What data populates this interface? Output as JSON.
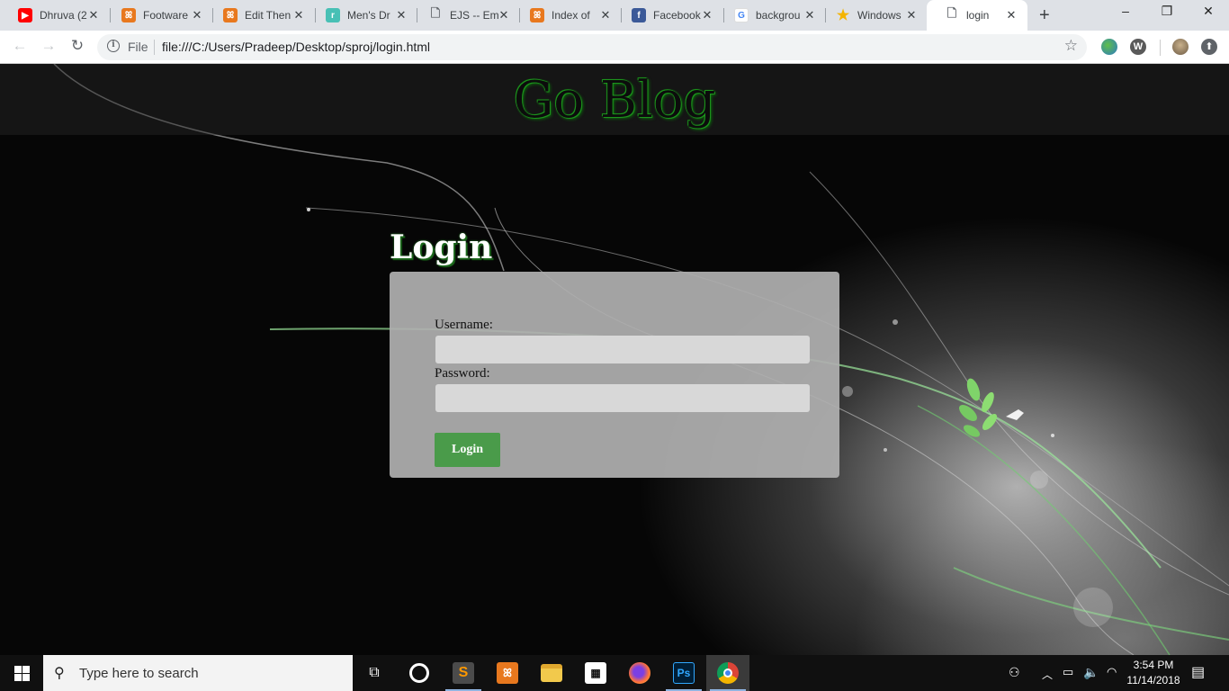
{
  "browser": {
    "tabs": [
      {
        "title": "Dhruva (2",
        "icon": "youtube-icon",
        "color": "#ff0000"
      },
      {
        "title": "Footware",
        "icon": "xampp-icon",
        "color": "#e8781e"
      },
      {
        "title": "Edit Then",
        "icon": "xampp-icon",
        "color": "#e8781e"
      },
      {
        "title": "Men's Dr",
        "icon": "site-icon",
        "color": "#48c0b5"
      },
      {
        "title": "EJS -- Em",
        "icon": "document-icon",
        "color": "#5f6368"
      },
      {
        "title": "Index of",
        "icon": "xampp-icon",
        "color": "#e8781e"
      },
      {
        "title": "Facebook",
        "icon": "facebook-icon",
        "color": "#3b5998"
      },
      {
        "title": "backgrou",
        "icon": "google-icon",
        "color": "#4285f4"
      },
      {
        "title": "Windows",
        "icon": "star-icon",
        "color": "#f4b400"
      },
      {
        "title": "login",
        "icon": "document-icon",
        "color": "#5f6368"
      }
    ],
    "new_tab": "+",
    "window_controls": {
      "minimize": "–",
      "maximize": "❐",
      "close": "✕"
    },
    "omnibox": {
      "scheme_label": "File",
      "url": "file:///C:/Users/Pradeep/Desktop/sproj/login.html"
    }
  },
  "page": {
    "site_title": "Go Blog",
    "login_heading": "Login",
    "username_label": "Username:",
    "password_label": "Password:",
    "username_value": "",
    "password_value": "",
    "login_button": "Login",
    "colors": {
      "button": "#4a9b4a",
      "title_glow": "#1a8a1a"
    }
  },
  "taskbar": {
    "search_placeholder": "Type here to search",
    "apps": [
      "task-view",
      "cortana",
      "sublime-text",
      "xampp",
      "file-explorer",
      "movies-tv",
      "firefox",
      "photoshop",
      "chrome"
    ],
    "time": "3:54 PM",
    "date": "11/14/2018"
  }
}
